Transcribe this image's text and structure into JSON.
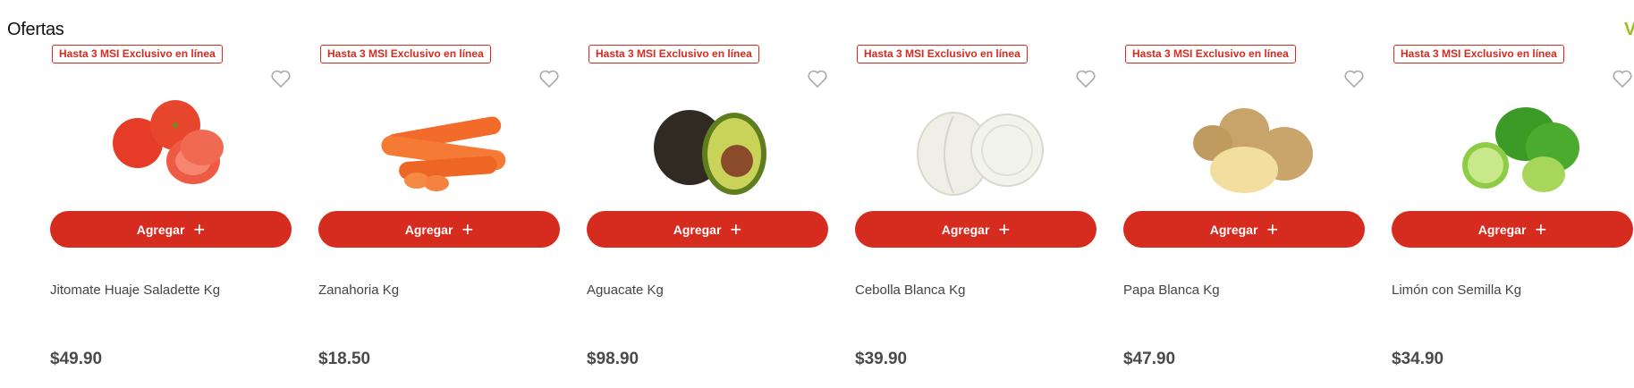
{
  "section": {
    "title": "Ofertas",
    "see_all": "Ver todo"
  },
  "colors": {
    "accent": "#d62b1f",
    "see_all": "#9bbf1f"
  },
  "products": [
    {
      "badge": "Hasta 3 MSI Exclusivo en línea",
      "name": "Jitomate Huaje Saladette Kg",
      "price": "$49.90",
      "button": "Agregar",
      "image": "tomato-image"
    },
    {
      "badge": "Hasta 3 MSI Exclusivo en línea",
      "name": "Zanahoria Kg",
      "price": "$18.50",
      "button": "Agregar",
      "image": "carrot-image"
    },
    {
      "badge": "Hasta 3 MSI Exclusivo en línea",
      "name": "Aguacate Kg",
      "price": "$98.90",
      "button": "Agregar",
      "image": "avocado-image"
    },
    {
      "badge": "Hasta 3 MSI Exclusivo en línea",
      "name": "Cebolla Blanca Kg",
      "price": "$39.90",
      "button": "Agregar",
      "image": "onion-image"
    },
    {
      "badge": "Hasta 3 MSI Exclusivo en línea",
      "name": "Papa Blanca Kg",
      "price": "$47.90",
      "button": "Agregar",
      "image": "potato-image"
    },
    {
      "badge": "Hasta 3 MSI Exclusivo en línea",
      "name": "Limón con Semilla Kg",
      "price": "$34.90",
      "button": "Agregar",
      "image": "lime-image"
    }
  ]
}
